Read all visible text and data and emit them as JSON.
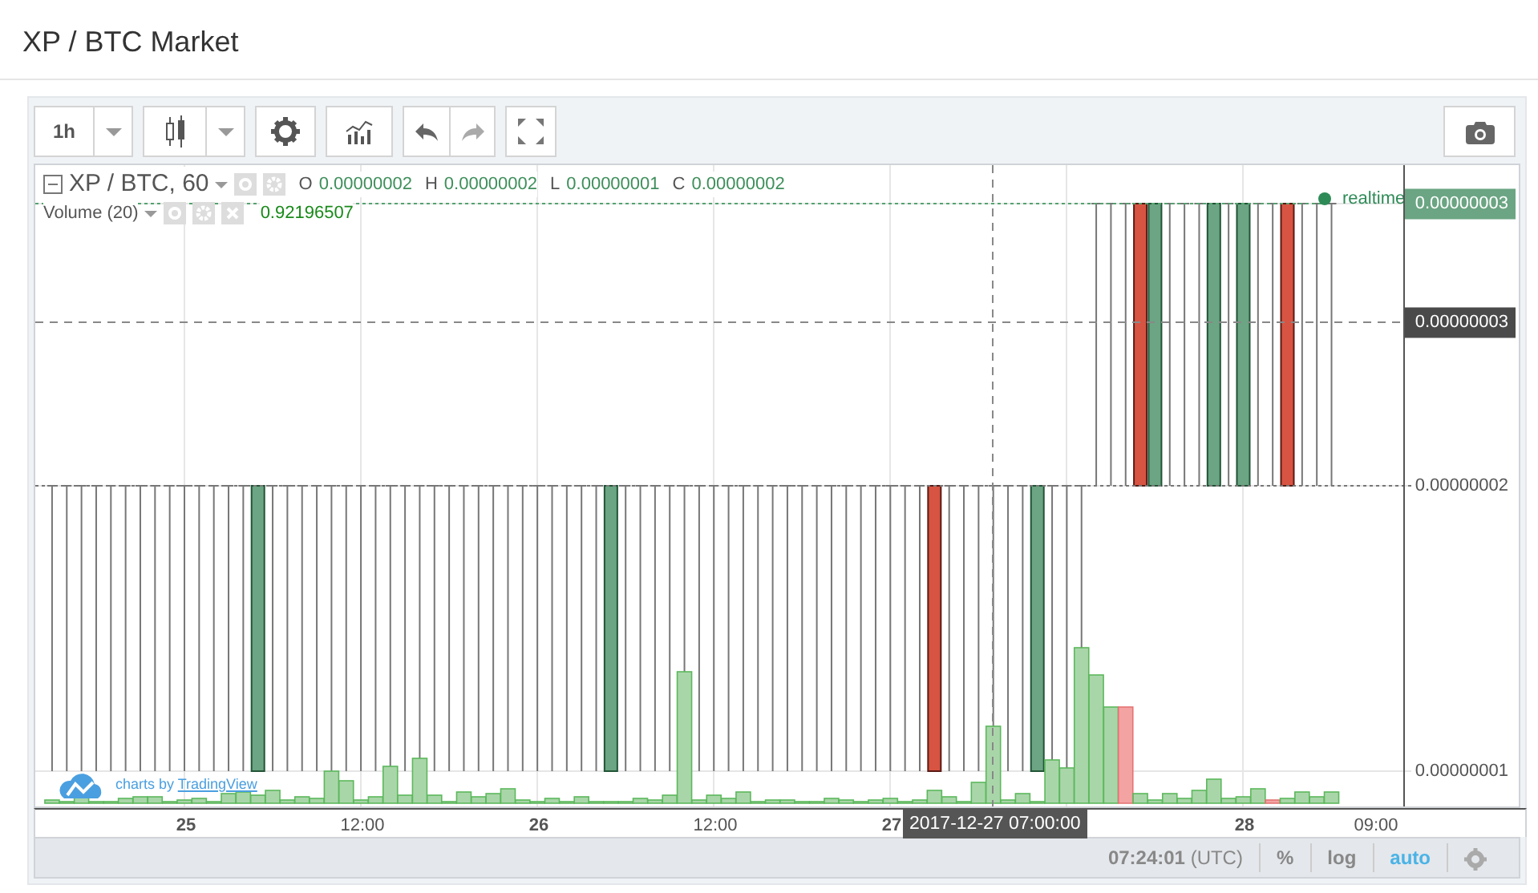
{
  "page_title": "XP / BTC Market",
  "toolbar": {
    "interval": "1h"
  },
  "legend": {
    "symbol": "XP / BTC, 60",
    "ohlc": [
      {
        "label": "O",
        "value": "0.00000002"
      },
      {
        "label": "H",
        "value": "0.00000002"
      },
      {
        "label": "L",
        "value": "0.00000001"
      },
      {
        "label": "C",
        "value": "0.00000002"
      }
    ],
    "volume_label": "Volume (20)",
    "volume_value": "0.92196507"
  },
  "realtime_label": "realtime",
  "price_axis": {
    "labels": [
      "0.00000002",
      "0.00000001"
    ],
    "last_price": "0.00000003",
    "crosshair_price": "0.00000003"
  },
  "time_axis": {
    "labels": [
      {
        "text": "25",
        "bold": true
      },
      {
        "text": "12:00",
        "bold": false
      },
      {
        "text": "26",
        "bold": true
      },
      {
        "text": "12:00",
        "bold": false
      },
      {
        "text": "27",
        "bold": true
      },
      {
        "text": "28",
        "bold": true
      },
      {
        "text": "09:00",
        "bold": false
      }
    ]
  },
  "crosshair_time": "2017-12-27 07:00:00",
  "attribution": {
    "prefix": "charts by",
    "link": "TradingView"
  },
  "status_bar": {
    "time": "07:24:01",
    "timezone": "(UTC)",
    "percent": "%",
    "log": "log",
    "auto": "auto",
    "auto_on": true
  }
}
